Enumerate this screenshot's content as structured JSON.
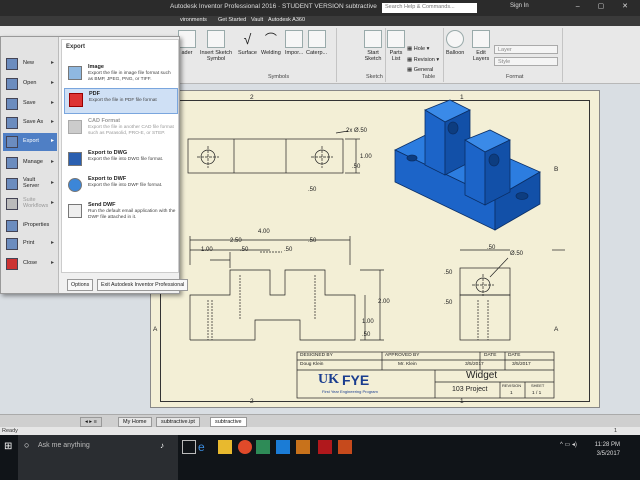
{
  "window": {
    "title": "Autodesk Inventor Professional 2016 · STUDENT VERSION  subtractive",
    "search_placeholder": "Search Help & Commands...",
    "signin": "Sign In"
  },
  "ribbon_tabs": [
    "vironments",
    "Get Started",
    "Vault",
    "Autodesk A360"
  ],
  "ribbon": {
    "buttons": [
      "ader",
      "Insert Sketch Symbol",
      "Surface",
      "Welding",
      "Impor...",
      "Caterp...",
      "Start Sketch",
      "Parts List",
      "Balloon",
      "Edit Layers"
    ],
    "dropdowns": [
      "Hole",
      "Revision",
      "General"
    ],
    "groups": [
      "Symbols",
      "Sketch",
      "Table",
      "Format"
    ],
    "layer_placeholder": "Layer",
    "style_placeholder": "Style"
  },
  "app_menu": {
    "left_items": [
      {
        "label": "New",
        "arrow": true
      },
      {
        "label": "Open",
        "arrow": true
      },
      {
        "label": "Save",
        "arrow": true
      },
      {
        "label": "Save As",
        "arrow": true
      },
      {
        "label": "Export",
        "arrow": true,
        "active": true
      },
      {
        "label": "Manage",
        "arrow": true
      },
      {
        "label": "Vault Server",
        "arrow": true
      },
      {
        "label": "Suite Workflows",
        "arrow": true,
        "disabled": true
      },
      {
        "label": "iProperties",
        "arrow": false
      },
      {
        "label": "Print",
        "arrow": true
      },
      {
        "label": "Close",
        "arrow": true
      }
    ],
    "panel_title": "Export",
    "export_items": [
      {
        "title": "Image",
        "desc": "Export the file in image file format such as BMP, JPEG, PNG, or TIFF."
      },
      {
        "title": "PDF",
        "desc": "Export the file in PDF file format",
        "selected": true
      },
      {
        "title": "CAD Format",
        "desc": "Export the file in another CAD file format such as Parasolid, PRO-E, or STEP.",
        "disabled": true
      },
      {
        "title": "Export to DWG",
        "desc": "Export the file into DWG file format."
      },
      {
        "title": "Export to DWF",
        "desc": "Export the file into DWF file format."
      },
      {
        "title": "Send DWF",
        "desc": "Run the default email application with the DWF file attached in it."
      }
    ],
    "options_label": "Options",
    "exit_label": "Exit Autodesk Inventor Professional"
  },
  "drawing": {
    "zones_top": [
      "2",
      "1"
    ],
    "zones_side": [
      "B",
      "A"
    ],
    "dims": {
      "holes": "2x Ø.50",
      "top_h1": "1.00",
      "top_h2": ".50",
      "top_w": ".50",
      "front_total": "4.00",
      "front_250": "2.50",
      "front_50a": ".50",
      "front_100": "1.00",
      "front_50b": ".50",
      "front_50c": ".50",
      "front_200": "2.00",
      "front_100v": "1.00",
      "front_50v": ".50",
      "side_dia": "Ø.50",
      "side_50a": ".50",
      "side_50b": ".50",
      "side_50c": ".50"
    }
  },
  "title_block": {
    "designed_by_label": "DESIGNED BY",
    "designed_by": "Doug Klein",
    "approved_by_label": "APPROVED BY",
    "approved_by": "Mr. Klein",
    "date_label": "DATE",
    "date1": "3/5/2017",
    "date2": "3/5/2017",
    "logo_text": "FYE",
    "logo_sub": "First Year Engineering Program",
    "title": "Widget",
    "project": "103 Project",
    "revision_label": "REVISION",
    "revision": "1",
    "sheet_label": "SHEET",
    "sheet": "1 / 1"
  },
  "doc_tabs": [
    "My Home",
    "subtractive.ipt",
    "subtractive"
  ],
  "status": {
    "left": "Ready",
    "right": "1"
  },
  "taskbar": {
    "search_text": "Ask me anything",
    "time": "11:28 PM",
    "date": "3/5/2017"
  },
  "colors": {
    "part_blue": "#1c64c8",
    "sheet": "#f3efd6",
    "menu_active": "#4f7fc5"
  }
}
